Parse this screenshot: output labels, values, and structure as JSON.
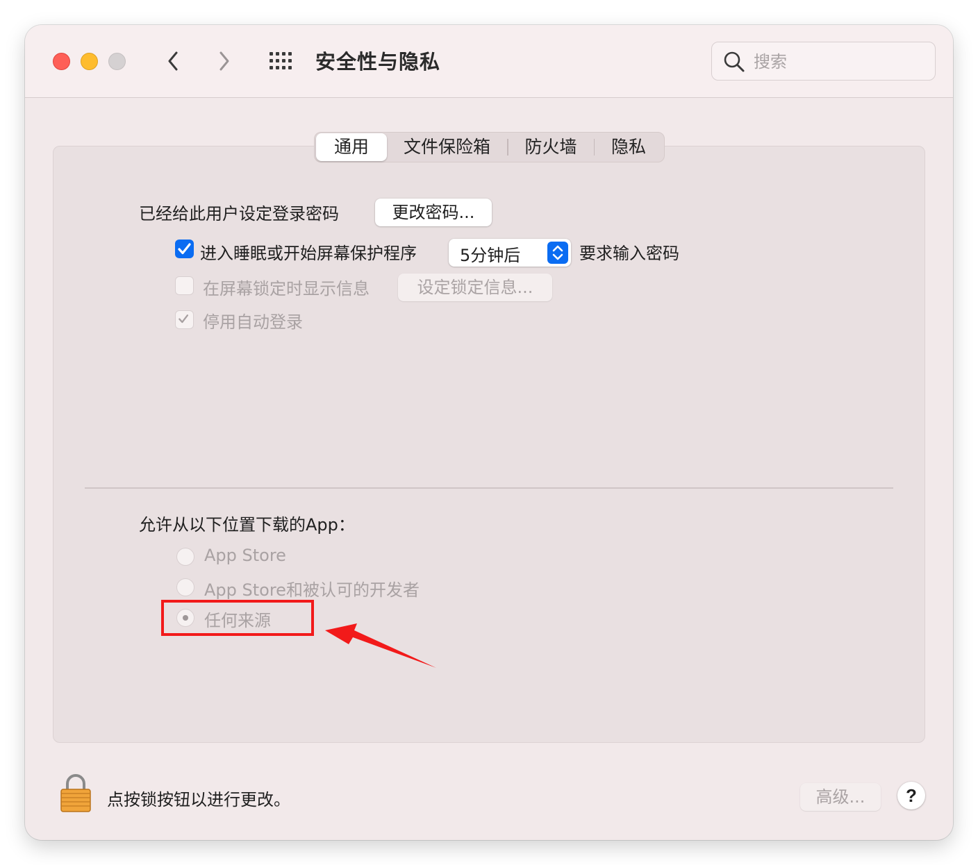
{
  "window": {
    "title": "安全性与隐私",
    "search_placeholder": "搜索"
  },
  "tabs": [
    {
      "label": "通用",
      "active": true
    },
    {
      "label": "文件保险箱",
      "active": false
    },
    {
      "label": "防火墙",
      "active": false
    },
    {
      "label": "隐私",
      "active": false
    }
  ],
  "general": {
    "password_label": "已经给此用户设定登录密码",
    "change_password_button": "更改密码...",
    "require_password": {
      "checked": true,
      "label": "进入睡眠或开始屏幕保护程序",
      "delay_value": "5分钟后",
      "suffix": "要求输入密码"
    },
    "lock_message": {
      "checked": false,
      "enabled": false,
      "label": "在屏幕锁定时显示信息",
      "button": "设定锁定信息..."
    },
    "disable_auto_login": {
      "checked": true,
      "enabled": false,
      "label": "停用自动登录"
    }
  },
  "downloads": {
    "heading": "允许从以下位置下载的App：",
    "options": [
      {
        "label": "App Store",
        "selected": false
      },
      {
        "label": "App Store和被认可的开发者",
        "selected": false
      },
      {
        "label": "任何来源",
        "selected": true
      }
    ]
  },
  "footer": {
    "lock_text": "点按锁按钮以进行更改。",
    "advanced_button": "高级...",
    "help_button": "?"
  },
  "colors": {
    "accent": "#0a6cf2",
    "annotation_red": "#f21a1a"
  }
}
